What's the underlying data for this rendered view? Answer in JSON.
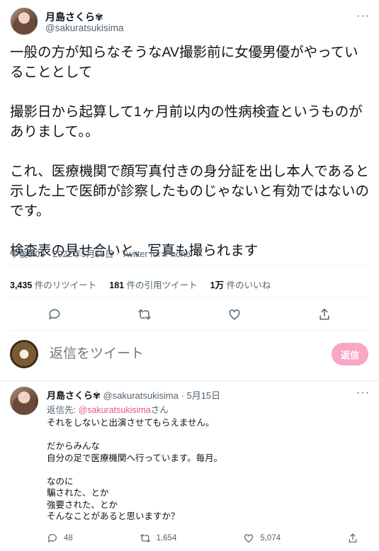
{
  "tweet": {
    "display_name": "月島さくら✾",
    "handle": "@sakuratsukisima",
    "more": "···",
    "text": "一般の方が知らなそうなAV撮影前に女優男優がやっていることとして\n\n撮影日から起算して1ヶ月前以内の性病検査というものがありまして。。\n\nこれ、医療機関で顔写真付きの身分証を出し本人であると示した上で医師が診察したものじゃないと有効ではないのです。\n\n検査表の見せ合いと、写真も撮られます",
    "time": "午後8:03 · 2022年5月15日",
    "source": "Twitter for iPhone",
    "stats": {
      "retweets_count": "3,435",
      "retweets_label": "件のリツイート",
      "quotes_count": "181",
      "quotes_label": "件の引用ツイート",
      "likes_count": "1万",
      "likes_label": "件のいいね"
    }
  },
  "reply_box": {
    "placeholder": "返信をツイート",
    "button": "返信"
  },
  "reply": {
    "display_name": "月島さくら✾",
    "handle_time": "@sakuratsukisima · 5月15日",
    "more": "···",
    "to_label": "返信先: ",
    "to_handle": "@sakuratsukisima",
    "to_suffix": "さん",
    "text": "それをしないと出演させてもらえません。\n\nだからみんな\n自分の足で医療機関へ行っています。毎月。\n\nなのに\n騙された、とか\n強要された、とか\nそんなことがあると思いますか？",
    "replies": "48",
    "retweets": "1,654",
    "likes": "5,074"
  },
  "colors": {
    "accent": "#f7a6c5",
    "link": "#e4558f",
    "muted": "#536471"
  }
}
